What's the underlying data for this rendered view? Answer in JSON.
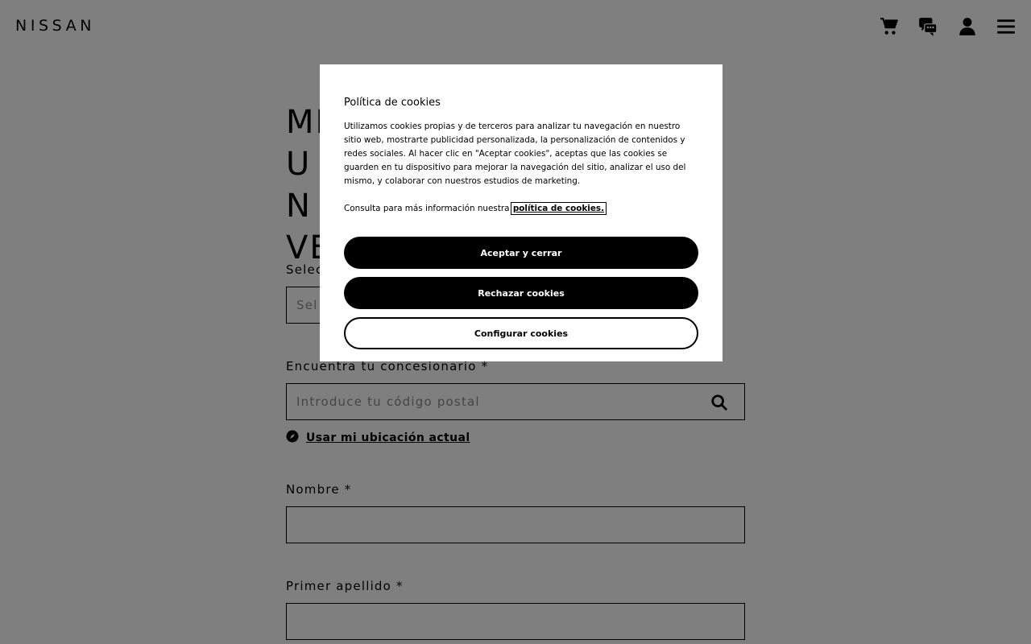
{
  "header": {
    "logo": "NISSAN",
    "icons": [
      "cart-icon",
      "chat-icon",
      "user-icon",
      "menu-icon"
    ]
  },
  "form": {
    "title": "MI UN VE",
    "select_label": "Selec",
    "select_placeholder": "Sel",
    "dealer_label": "Encuentra tu concesionario *",
    "dealer_placeholder": "Introduce tu código postal",
    "location_link": "Usar mi ubicación actual",
    "name_label": "Nombre  *",
    "surname_label": "Primer apellido  *"
  },
  "cookie_modal": {
    "title": "Política de cookies",
    "text": "Utilizamos cookies propias y de terceros para analizar tu navegación en nuestro sitio web, mostrarte publicidad personalizada, la personalización de contenidos y redes sociales. Al hacer clic en \"Aceptar cookies\", aceptas que las cookies se guarden en tu dispositivo para mejorar la navegación del sitio, analizar el uso del mismo, y colaborar con nuestros estudios de marketing.",
    "more_info": "Consulta para más información nuestra ",
    "policy_link": "política de cookies.",
    "accept_button": "Aceptar y cerrar",
    "reject_button": "Rechazar cookies",
    "configure_button": "Configurar cookies"
  }
}
